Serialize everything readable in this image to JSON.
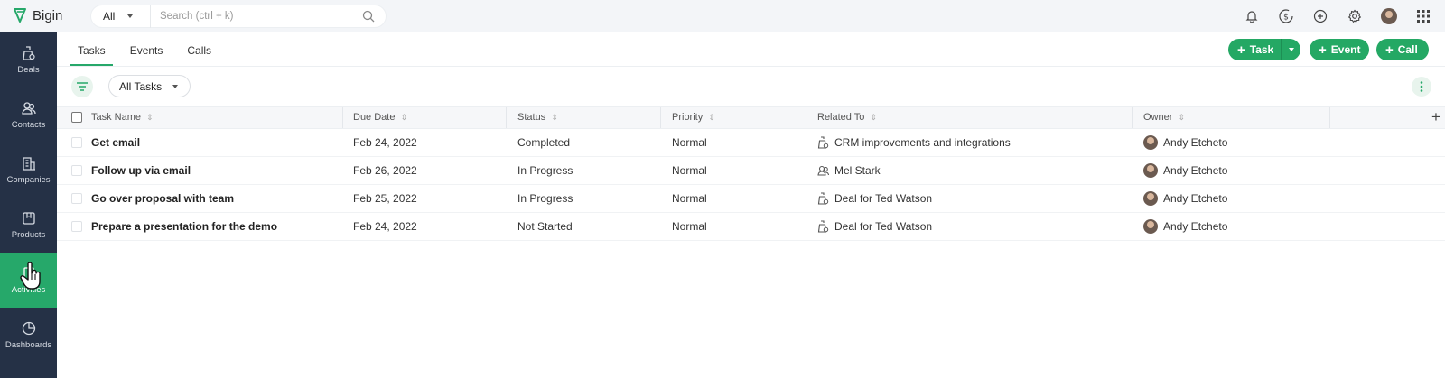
{
  "app": {
    "name": "Bigin",
    "accent": "#26a86a",
    "sidebar_bg": "#253146"
  },
  "search": {
    "scope": "All",
    "placeholder": "Search (ctrl + k)"
  },
  "top_icons": [
    "bell-icon",
    "dollar-sync-icon",
    "add-circle-icon",
    "settings-icon",
    "avatar",
    "apps-grid-icon"
  ],
  "sidebar": {
    "items": [
      {
        "label": "Deals",
        "icon": "deals-icon"
      },
      {
        "label": "Contacts",
        "icon": "contacts-icon"
      },
      {
        "label": "Companies",
        "icon": "companies-icon"
      },
      {
        "label": "Products",
        "icon": "products-icon"
      },
      {
        "label": "Activities",
        "icon": "activities-icon",
        "active": true
      },
      {
        "label": "Dashboards",
        "icon": "dashboards-icon"
      }
    ]
  },
  "tabs": [
    {
      "label": "Tasks",
      "active": true
    },
    {
      "label": "Events"
    },
    {
      "label": "Calls"
    }
  ],
  "actions": {
    "task": "Task",
    "event": "Event",
    "call": "Call"
  },
  "view": {
    "selected": "All Tasks"
  },
  "table": {
    "columns": [
      "Task Name",
      "Due Date",
      "Status",
      "Priority",
      "Related To",
      "Owner"
    ],
    "rows": [
      {
        "task": "Get email",
        "due": "Feb 24, 2022",
        "status": "Completed",
        "priority": "Normal",
        "related": "CRM improvements and integrations",
        "related_icon": "deal-icon",
        "owner": "Andy Etcheto"
      },
      {
        "task": "Follow up via email",
        "due": "Feb 26, 2022",
        "status": "In Progress",
        "priority": "Normal",
        "related": "Mel Stark",
        "related_icon": "contact-icon",
        "owner": "Andy Etcheto"
      },
      {
        "task": "Go over proposal with team",
        "due": "Feb 25, 2022",
        "status": "In Progress",
        "priority": "Normal",
        "related": "Deal for Ted Watson",
        "related_icon": "deal-icon",
        "owner": "Andy Etcheto"
      },
      {
        "task": "Prepare a presentation for the demo",
        "due": "Feb 24, 2022",
        "status": "Not Started",
        "priority": "Normal",
        "related": "Deal for Ted Watson",
        "related_icon": "deal-icon",
        "owner": "Andy Etcheto"
      }
    ]
  }
}
